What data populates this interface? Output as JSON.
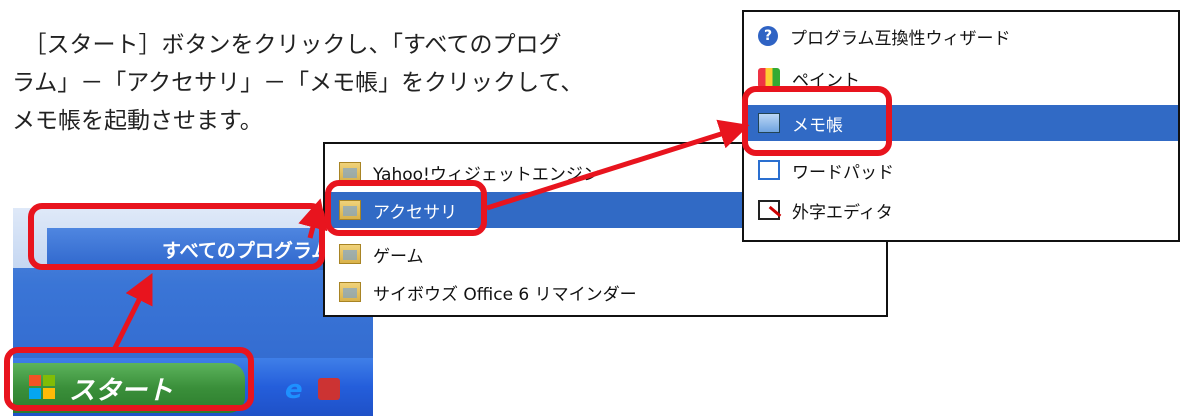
{
  "instruction": {
    "text": "　［スタート］ボタンをクリックし、「すべてのプログ\nラム」－「アクセサリ」－「メモ帳」をクリックして、\nメモ帳を起動させます。"
  },
  "start_menu": {
    "all_programs_label": "すべてのプログラム(",
    "start_button_label": "スタート"
  },
  "programs_menu": {
    "items": [
      {
        "label": "Yahoo!ウィジェットエンジン",
        "icon": "folder-icon"
      },
      {
        "label": "アクセサリ",
        "icon": "folder-icon"
      },
      {
        "label": "ゲーム",
        "icon": "folder-icon"
      },
      {
        "label": "サイボウズ Office 6 リマインダー",
        "icon": "folder-icon"
      }
    ]
  },
  "accessories_menu": {
    "items": [
      {
        "label": "プログラム互換性ウィザード",
        "icon": "help-icon"
      },
      {
        "label": "ペイント",
        "icon": "paint-icon"
      },
      {
        "label": "メモ帳",
        "icon": "notepad-icon"
      },
      {
        "label": "ワードパッド",
        "icon": "wordpad-icon"
      },
      {
        "label": "外字エディタ",
        "icon": "eudc-icon"
      }
    ]
  },
  "colors": {
    "highlight": "#316ac5",
    "annotation": "#e8141e"
  }
}
